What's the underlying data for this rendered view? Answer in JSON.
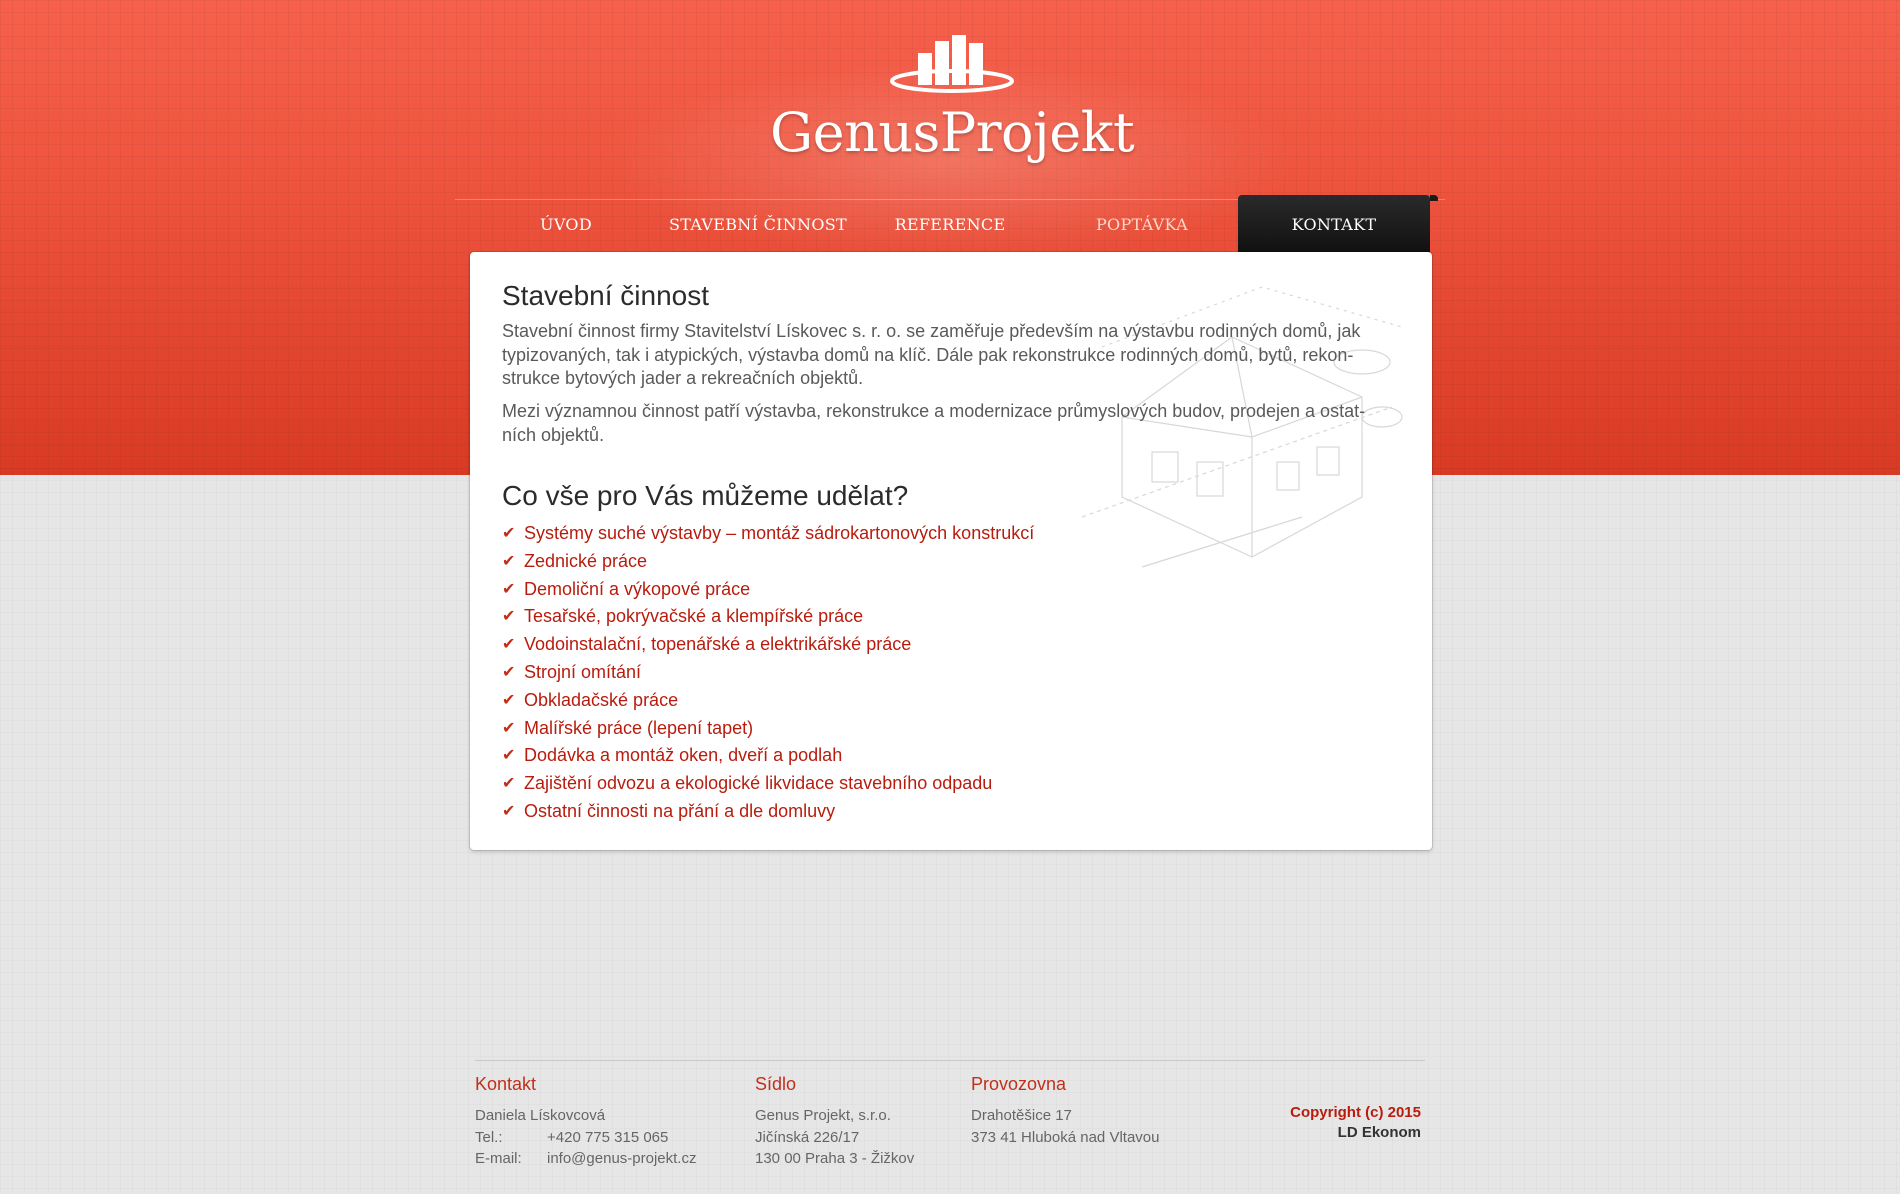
{
  "brand": {
    "logo_text": "GenusProjekt",
    "logo_text_part1": "Genus",
    "logo_text_part2": "Projekt",
    "accent_color": "#ee533d",
    "text_red": "#b81c0e"
  },
  "nav": {
    "items": [
      {
        "label": "ÚVOD"
      },
      {
        "label": "STAVEBNÍ ČINNOST"
      },
      {
        "label": "REFERENCE"
      },
      {
        "label": "POPTÁVKA"
      },
      {
        "label": "KONTAKT"
      }
    ],
    "active": "KONTAKT"
  },
  "content": {
    "title": "Stavební činnost",
    "paragraph1": "Stavební činnost firmy Stavitelství Lískovec s. r. o. se zaměřuje především na výstavbu rodinných domů, jak typizovaných, tak i atypických, výstavba domů na klíč. Dále pak rekonstrukce rodinných domů, bytů, rekon-strukce bytových jader a rekreačních objektů.",
    "paragraph2": "Mezi významnou činnost patří výstavba, rekonstrukce a modernizace průmyslových budov, prodejen a ostat-ních objektů.",
    "subtitle": "Co vše pro Vás můžeme udělat?",
    "services": [
      "Systémy suché výstavby – montáž sádrokartonových konstrukcí",
      "Zednické práce",
      "Demoliční a výkopové práce",
      "Tesařské, pokrývačské a klempířské práce",
      "Vodoinstalační, topenářské a elektrikářské práce",
      "Strojní omítání",
      "Obkladačské práce",
      "Malířské práce (lepení tapet)",
      "Dodávka a montáž oken, dveří a podlah",
      "Zajištění odvozu a ekologické likvidace stavebního odpadu",
      "Ostatní činnosti na přání a dle domluvy"
    ]
  },
  "footer": {
    "contact": {
      "heading": "Kontakt",
      "name": "Daniela Lískovcová",
      "tel_label": "Tel.:",
      "tel": "+420 775 315 065",
      "email_label": "E-mail:",
      "email": "info@genus-projekt.cz"
    },
    "seat": {
      "heading": "Sídlo",
      "line1": "Genus Projekt, s.r.o.",
      "line2": "Jičínská 226/17",
      "line3": "130 00  Praha 3 - Žižkov"
    },
    "branch": {
      "heading": "Provozovna",
      "line1": "Drahotěšice 17",
      "line2": "373 41  Hluboká nad Vltavou"
    },
    "copyright": "Copyright (c) 2015",
    "author": "LD Ekonom"
  }
}
